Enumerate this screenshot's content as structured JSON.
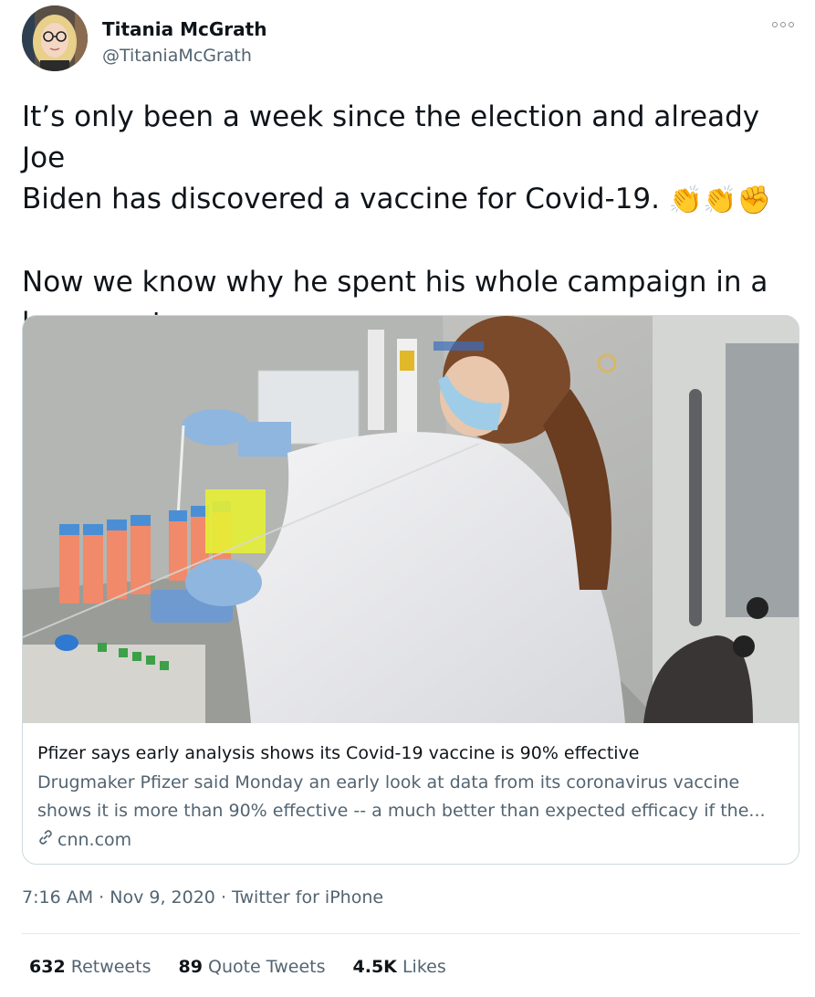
{
  "author": {
    "name": "Titania McGrath",
    "handle": "@TitaniaMcGrath"
  },
  "tweet": {
    "line1": "It’s only been a week since the election and already Joe",
    "line2": "Biden has discovered a vaccine for Covid-19.",
    "emoji": [
      "clapping-hands-emoji",
      "clapping-hands-emoji",
      "raised-fist-emoji"
    ],
    "line3": "Now we know why he spent his whole campaign in a",
    "line4": "basement."
  },
  "card": {
    "title": "Pfizer says early analysis shows its Covid-19 vaccine is 90% effective",
    "desc1": "Drugmaker Pfizer said Monday an early look at data from its coronavirus vaccine",
    "desc2": "shows it is more than 90% effective -- a much better than expected efficacy if the...",
    "domain": "cnn.com"
  },
  "meta": {
    "time": "7:16 AM",
    "date": "Nov 9, 2020",
    "source": "Twitter for iPhone",
    "sep": "·"
  },
  "stats": {
    "retweets_count": "632",
    "retweets_label": "Retweets",
    "quotes_count": "89",
    "quotes_label": "Quote Tweets",
    "likes_count": "4.5K",
    "likes_label": "Likes"
  },
  "colors": {
    "text": "#0f1419",
    "secondary": "#536471",
    "border": "#cfd9de"
  }
}
